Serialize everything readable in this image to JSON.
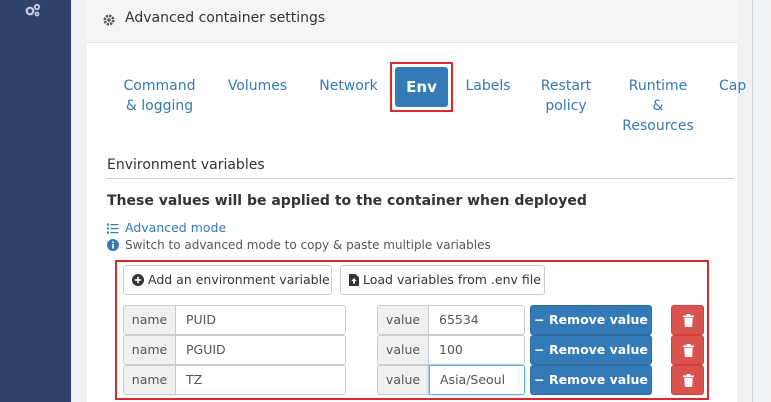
{
  "sidebar": {
    "icon": "cogs-icon"
  },
  "header": {
    "title": "Advanced container settings",
    "icon": "gear-icon"
  },
  "tabs": [
    {
      "line1": "Command",
      "line2": "& logging",
      "line3": ""
    },
    {
      "line1": "Volumes",
      "line2": "",
      "line3": ""
    },
    {
      "line1": "Network",
      "line2": "",
      "line3": ""
    },
    {
      "line1": "Env",
      "line2": "",
      "line3": ""
    },
    {
      "line1": "Labels",
      "line2": "",
      "line3": ""
    },
    {
      "line1": "Restart",
      "line2": "policy",
      "line3": ""
    },
    {
      "line1": "Runtime",
      "line2": "&",
      "line3": "Resources"
    },
    {
      "line1": "Cap",
      "line2": "",
      "line3": ""
    }
  ],
  "active_tab": "Env",
  "env": {
    "section_title": "Environment variables",
    "description": "These values will be applied to the container when deployed",
    "advanced_mode_label": "Advanced mode",
    "hint": "Switch to advanced mode to copy & paste multiple variables",
    "add_label": "Add an environment variable",
    "load_label": "Load variables from .env file",
    "name_addon": "name",
    "value_addon": "value",
    "remove_label": "Remove value",
    "rows": [
      {
        "name": "PUID",
        "value": "65534"
      },
      {
        "name": "PGUID",
        "value": "100"
      },
      {
        "name": "TZ",
        "value": "Asia/Seoul"
      }
    ]
  },
  "colors": {
    "sidebar": "#30426a",
    "primary": "#337ab7",
    "danger": "#d9534f",
    "highlight": "#d9282f"
  }
}
